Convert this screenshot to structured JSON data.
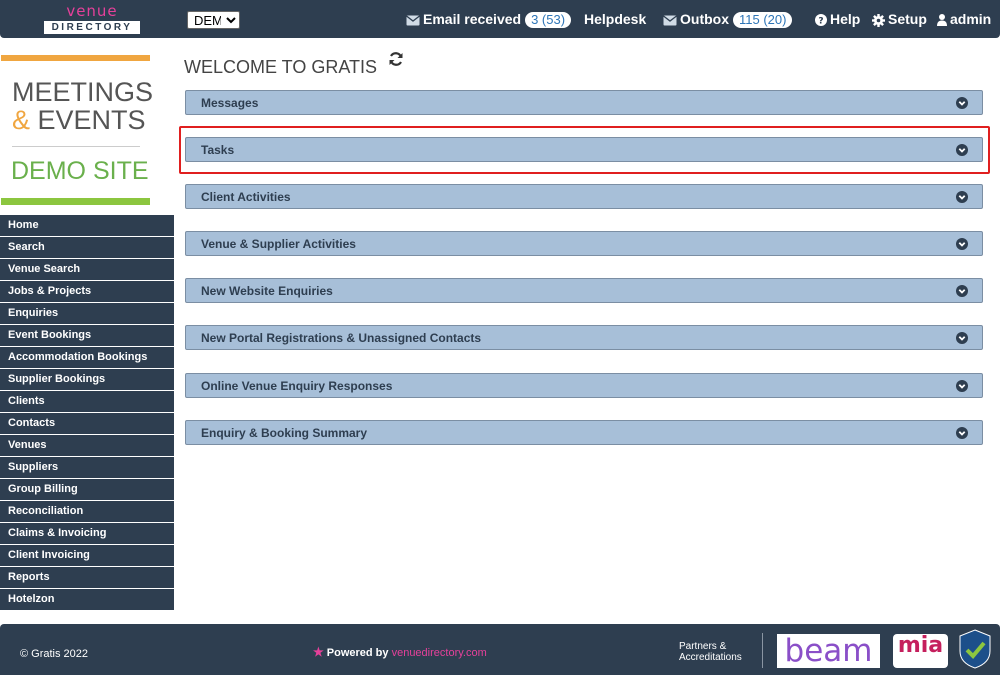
{
  "header": {
    "logo_top": "venue",
    "logo_bottom": "DIRECTORY",
    "site_selector": {
      "selected": "DEM",
      "options": [
        "DEM"
      ]
    },
    "email": {
      "label": "Email received",
      "count": "3 (53)"
    },
    "helpdesk": "Helpdesk",
    "outbox": {
      "label": "Outbox",
      "count": "115 (20)"
    },
    "help": "Help",
    "setup": "Setup",
    "user": "admin"
  },
  "branding": {
    "line1": "MEETINGS",
    "amp": "&",
    "line2": "EVENTS",
    "demo": "DEMO SITE",
    "colors": {
      "orange": "#f0a640",
      "green": "#8cc63f",
      "text": "#555555"
    }
  },
  "sidebar": {
    "items": [
      "Home",
      "Search",
      "Venue Search",
      "Jobs & Projects",
      "Enquiries",
      "Event Bookings",
      "Accommodation Bookings",
      "Supplier Bookings",
      "Clients",
      "Contacts",
      "Venues",
      "Suppliers",
      "Group Billing",
      "Reconciliation",
      "Claims & Invoicing",
      "Client Invoicing",
      "Reports",
      "Hotelzon"
    ]
  },
  "main": {
    "title": "WELCOME TO GRATIS",
    "panels": [
      {
        "title": "Messages",
        "highlighted": false
      },
      {
        "title": "Tasks",
        "highlighted": true
      },
      {
        "title": "Client Activities",
        "highlighted": false
      },
      {
        "title": "Venue & Supplier Activities",
        "highlighted": false
      },
      {
        "title": "New Website Enquiries",
        "highlighted": false
      },
      {
        "title": "New Portal Registrations & Unassigned Contacts",
        "highlighted": false
      },
      {
        "title": "Online Venue Enquiry Responses",
        "highlighted": false
      },
      {
        "title": "Enquiry & Booking Summary",
        "highlighted": false
      }
    ]
  },
  "footer": {
    "copyright": "© Gratis 2022",
    "powered_by": "Powered by",
    "powered_link": "venuedirectory.com",
    "partners_line1": "Partners &",
    "partners_line2": "Accreditations",
    "beam": "beam",
    "mia": "mia"
  },
  "colors": {
    "navbar": "#2e3e50",
    "panel": "#a7bfd8",
    "accent_pink": "#e6409a",
    "highlight": "#e01f1f"
  }
}
